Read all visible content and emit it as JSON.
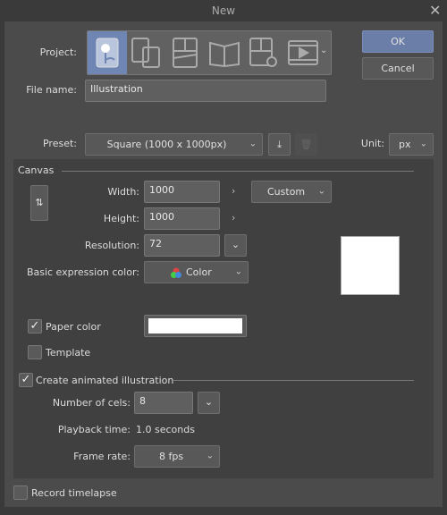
{
  "window": {
    "title": "New",
    "close_icon": "close-icon"
  },
  "project": {
    "label": "Project:",
    "types": [
      "illustration",
      "comic",
      "comic-page",
      "book",
      "comic-settings",
      "animation"
    ],
    "selected": "illustration",
    "accent": "#6f86b5"
  },
  "buttons": {
    "ok": "OK",
    "cancel": "Cancel"
  },
  "file_name": {
    "label": "File name:",
    "value": "Illustration"
  },
  "preset": {
    "label": "Preset:",
    "value": "Square (1000 x 1000px)"
  },
  "unit": {
    "label": "Unit:",
    "value": "px"
  },
  "canvas": {
    "section": "Canvas",
    "width": {
      "label": "Width:",
      "value": "1000"
    },
    "height": {
      "label": "Height:",
      "value": "1000"
    },
    "size_preset": "Custom",
    "resolution": {
      "label": "Resolution:",
      "value": "72"
    },
    "expression_color": {
      "label": "Basic expression color:",
      "value": "Color"
    },
    "paper_color": {
      "label": "Paper color",
      "checked": true,
      "color": "#ffffff"
    },
    "template": {
      "label": "Template",
      "checked": false
    }
  },
  "animation": {
    "label": "Create animated illustration",
    "checked": true,
    "cels": {
      "label": "Number of cels:",
      "value": "8"
    },
    "playback": {
      "label": "Playback time:",
      "value": "1.0 seconds"
    },
    "frame_rate": {
      "label": "Frame rate:",
      "value": "8 fps"
    }
  },
  "timelapse": {
    "label": "Record timelapse",
    "checked": false
  }
}
